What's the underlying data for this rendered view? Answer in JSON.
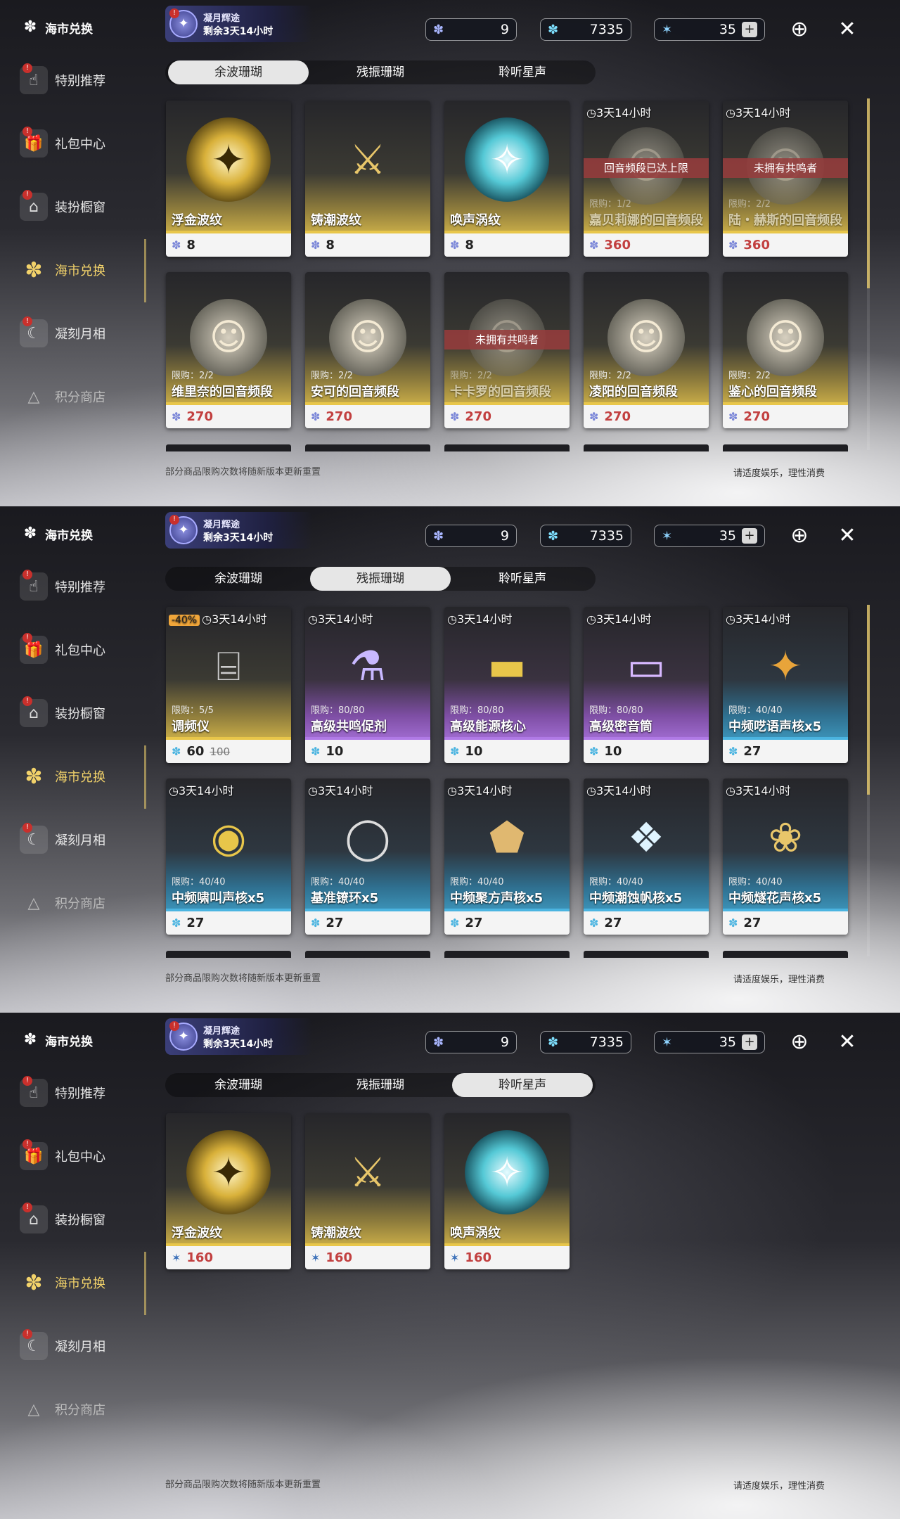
{
  "sidebar": {
    "title": "海市兑换",
    "items": [
      {
        "label": "特别推荐",
        "icon": "hand-icon"
      },
      {
        "label": "礼包中心",
        "icon": "gift-icon"
      },
      {
        "label": "装扮橱窗",
        "icon": "house-icon"
      },
      {
        "label": "海市兑换",
        "icon": "coral-icon"
      },
      {
        "label": "凝刻月相",
        "icon": "moon-icon"
      },
      {
        "label": "积分商店",
        "icon": "triangle-icon"
      }
    ]
  },
  "event": {
    "title": "凝月辉途",
    "countdown": "剩余3天14小时"
  },
  "currency": {
    "c1": "9",
    "c2": "7335",
    "c3": "35",
    "plus": "+"
  },
  "tabs": [
    "余波珊瑚",
    "残振珊瑚",
    "聆听星声"
  ],
  "footer": {
    "note": "部分商品限购次数将随新版本更新重置",
    "advice": "请适度娱乐，理性消费"
  },
  "panel1": {
    "row1": [
      {
        "name": "浮金波纹",
        "price": "8"
      },
      {
        "name": "铸潮波纹",
        "price": "8"
      },
      {
        "name": "唤声涡纹",
        "price": "8"
      },
      {
        "timer": "3天14小时",
        "banner": "回音频段已达上限",
        "limit": "限购：1/2",
        "name": "嘉贝莉娜的回音频段",
        "price": "360"
      },
      {
        "timer": "3天14小时",
        "banner": "未拥有共鸣者",
        "limit": "限购：2/2",
        "name": "陆・赫斯的回音频段",
        "price": "360"
      }
    ],
    "row2": [
      {
        "limit": "限购：2/2",
        "name": "维里奈的回音频段",
        "price": "270"
      },
      {
        "limit": "限购：2/2",
        "name": "安可的回音频段",
        "price": "270"
      },
      {
        "banner": "未拥有共鸣者",
        "limit": "限购：2/2",
        "name": "卡卡罗的回音频段",
        "price": "270"
      },
      {
        "limit": "限购：2/2",
        "name": "凌阳的回音频段",
        "price": "270"
      },
      {
        "limit": "限购：2/2",
        "name": "鉴心的回音频段",
        "price": "270"
      }
    ]
  },
  "panel2": {
    "row1": [
      {
        "discount": "-40%",
        "timer": "3天14小时",
        "limit": "限购：5/5",
        "name": "调频仪",
        "price": "60",
        "old_price": "100"
      },
      {
        "timer": "3天14小时",
        "limit": "限购：80/80",
        "name": "高级共鸣促剂",
        "price": "10"
      },
      {
        "timer": "3天14小时",
        "limit": "限购：80/80",
        "name": "高级能源核心",
        "price": "10"
      },
      {
        "timer": "3天14小时",
        "limit": "限购：80/80",
        "name": "高级密音筒",
        "price": "10"
      },
      {
        "timer": "3天14小时",
        "limit": "限购：40/40",
        "name": "中频呓语声核x5",
        "price": "27"
      }
    ],
    "row2": [
      {
        "timer": "3天14小时",
        "limit": "限购：40/40",
        "name": "中频啸叫声核x5",
        "price": "27"
      },
      {
        "timer": "3天14小时",
        "limit": "限购：40/40",
        "name": "基准镣环x5",
        "price": "27"
      },
      {
        "timer": "3天14小时",
        "limit": "限购：40/40",
        "name": "中频聚方声核x5",
        "price": "27"
      },
      {
        "timer": "3天14小时",
        "limit": "限购：40/40",
        "name": "中频潮蚀帆核x5",
        "price": "27"
      },
      {
        "timer": "3天14小时",
        "limit": "限购：40/40",
        "name": "中频燧花声核x5",
        "price": "27"
      }
    ]
  },
  "panel3": {
    "row1": [
      {
        "name": "浮金波纹",
        "price": "160"
      },
      {
        "name": "铸潮波纹",
        "price": "160"
      },
      {
        "name": "唤声涡纹",
        "price": "160"
      }
    ]
  },
  "colors": {
    "gold": "#e8c64a",
    "purple": "#b07ae6",
    "blue": "#4bb4e0",
    "active_nav": "#f2d26a"
  }
}
